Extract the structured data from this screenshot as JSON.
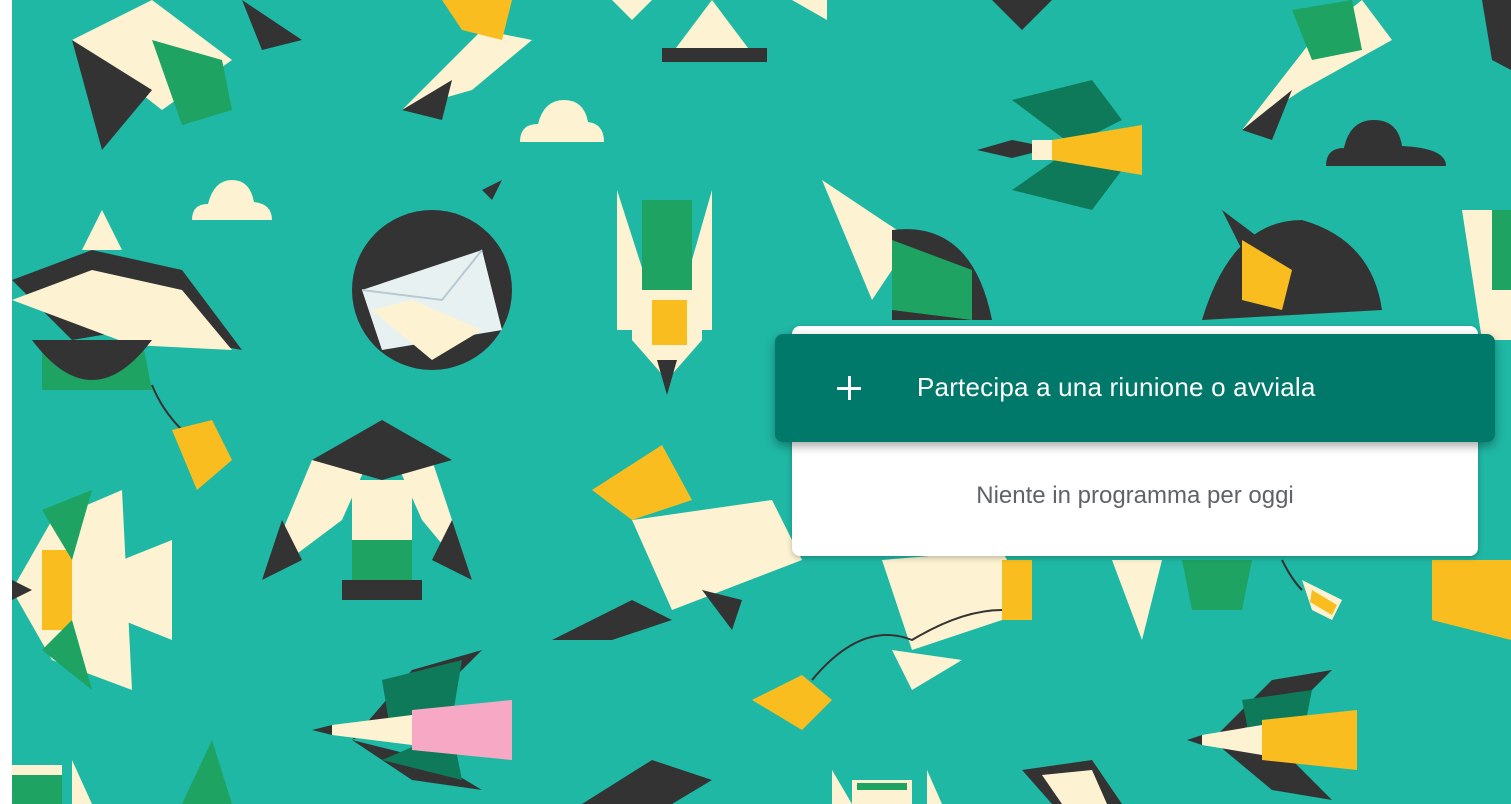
{
  "meeting": {
    "join_label": "Partecipa a una riunione o avviala",
    "empty_schedule": "Niente in programma per oggi",
    "icon": "plus-icon"
  },
  "colors": {
    "background": "#1fb8a4",
    "button": "#00796b",
    "card": "#ffffff",
    "bird_dark": "#3c3c3c",
    "bird_cream": "#fdf3d2",
    "bird_green": "#1ea362",
    "bird_yellow": "#f9bd20",
    "bird_pink": "#f7a8c4"
  }
}
